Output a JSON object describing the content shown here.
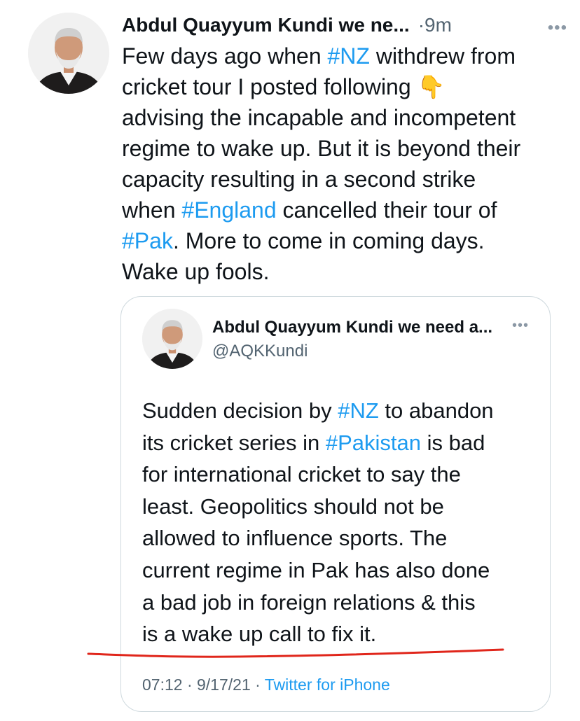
{
  "tweet": {
    "author_display": "Abdul Quayyum Kundi we ne...",
    "separator": "·",
    "time": "9m",
    "more_icon": "more-horizontal-icon",
    "body_parts": [
      {
        "text": "Few days ago when ",
        "hashtag": false
      },
      {
        "text": "#NZ",
        "hashtag": true
      },
      {
        "text": " withdrew from\ncricket tour I posted following ",
        "hashtag": false
      },
      {
        "text": "👇",
        "hashtag": false,
        "emoji": true
      },
      {
        "text": "\nadvising the incapable and incompetent\nregime to wake up. But it is beyond their\ncapacity resulting in a second strike\nwhen ",
        "hashtag": false
      },
      {
        "text": "#England",
        "hashtag": true
      },
      {
        "text": " cancelled their tour of\n",
        "hashtag": false
      },
      {
        "text": "#Pak",
        "hashtag": true
      },
      {
        "text": ". More to come in coming days.\nWake up fools.",
        "hashtag": false
      }
    ]
  },
  "quote": {
    "author_display": "Abdul Quayyum Kundi we need a...",
    "handle": "@AQKKundi",
    "body_parts": [
      {
        "text": "Sudden decision by ",
        "hashtag": false
      },
      {
        "text": "#NZ",
        "hashtag": true
      },
      {
        "text": " to abandon\nits cricket series in ",
        "hashtag": false
      },
      {
        "text": "#Pakistan",
        "hashtag": true
      },
      {
        "text": " is bad\nfor international cricket to say the\nleast. Geopolitics should not be\nallowed to influence sports. The\ncurrent regime in Pak has also done\na bad job in foreign relations & this\nis a wake up call to fix it.",
        "hashtag": false
      }
    ],
    "timestamp": "07:12 · 9/17/21",
    "separator": " · ",
    "source": "Twitter for iPhone"
  },
  "colors": {
    "link": "#1d9bf0",
    "secondary_text": "#536471",
    "annotation_underline": "#e0261b"
  }
}
